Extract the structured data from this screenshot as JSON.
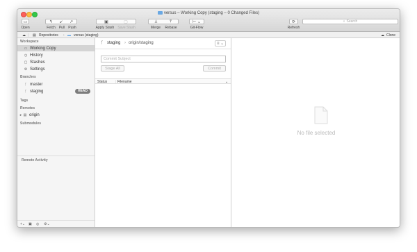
{
  "window": {
    "title": "versus – Working Copy (staging – 0 Changed Files)"
  },
  "toolbar": {
    "open": "Open",
    "fetch": "Fetch",
    "pull": "Pull",
    "push": "Push",
    "apply_stash": "Apply Stash",
    "save_stash": "Save Stash",
    "merge": "Merge",
    "rebase": "Rebase",
    "git_flow": "Git-Flow",
    "refresh": "Refresh",
    "search_placeholder": "Search"
  },
  "pathbar": {
    "repositories": "Repositories",
    "repo": "versus (staging)",
    "clone": "Clone"
  },
  "sidebar": {
    "workspace_title": "Workspace",
    "workspace_items": [
      "Working Copy",
      "History",
      "Stashes",
      "Settings"
    ],
    "branches_title": "Branches",
    "branches": [
      "master",
      "staging"
    ],
    "head_badge": "HEAD",
    "tags_title": "Tags",
    "remotes_title": "Remotes",
    "remotes": [
      "origin"
    ],
    "submodules_title": "Submodules",
    "remote_activity": "Remote Activity"
  },
  "commit": {
    "branch": "staging",
    "upstream": "origin/staging",
    "subject_placeholder": "Commit Subject",
    "stage_all": "Stage All",
    "commit_button": "Commit",
    "columns": [
      "Status",
      "Filename"
    ]
  },
  "detail": {
    "empty_text": "No file selected"
  },
  "colors": {
    "close": "#fc605c",
    "minimize": "#fdbc40",
    "maximize": "#34c84a",
    "selection": "#d4d4d4",
    "folder": "#6aa8e3"
  }
}
